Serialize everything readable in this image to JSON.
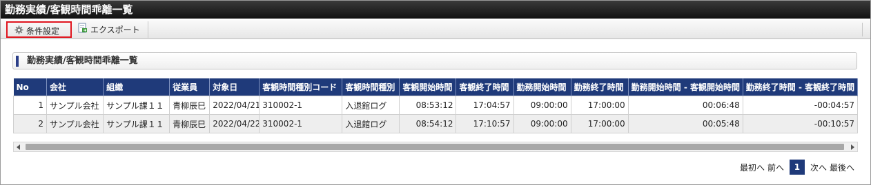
{
  "window": {
    "title": "勤務実績/客観時間乖離一覧"
  },
  "toolbar": {
    "condition_label": "条件設定",
    "export_label": "エクスポート"
  },
  "panel": {
    "title": "勤務実績/客観時間乖離一覧"
  },
  "table": {
    "headers": [
      "No",
      "会社",
      "組織",
      "従業員",
      "対象日",
      "客観時間種別コード",
      "客観時間種別",
      "客観開始時間",
      "客観終了時間",
      "勤務開始時間",
      "勤務終了時間",
      "勤務開始時間 - 客観開始時間",
      "勤務終了時間 - 客観終了時間"
    ],
    "rows": [
      [
        "1",
        "サンプル会社",
        "サンプル課１１",
        "青柳辰巳",
        "2022/04/21",
        "310002-1",
        "入退館ログ",
        "08:53:12",
        "17:04:57",
        "09:00:00",
        "17:00:00",
        "00:06:48",
        "-00:04:57"
      ],
      [
        "2",
        "サンプル会社",
        "サンプル課１１",
        "青柳辰巳",
        "2022/04/22",
        "310002-1",
        "入退館ログ",
        "08:54:12",
        "17:10:57",
        "09:00:00",
        "17:00:00",
        "00:05:48",
        "-00:10:57"
      ]
    ]
  },
  "pager": {
    "first": "最初へ",
    "prev": "前へ",
    "current": "1",
    "next": "次へ",
    "last": "最後へ"
  },
  "colors": {
    "header_bg": "#1f3a7a",
    "highlight_border": "#e0141e",
    "titlebar_bg": "#1a1a1a"
  },
  "icons": {
    "condition": "gear-icon",
    "export": "export-document-icon"
  }
}
